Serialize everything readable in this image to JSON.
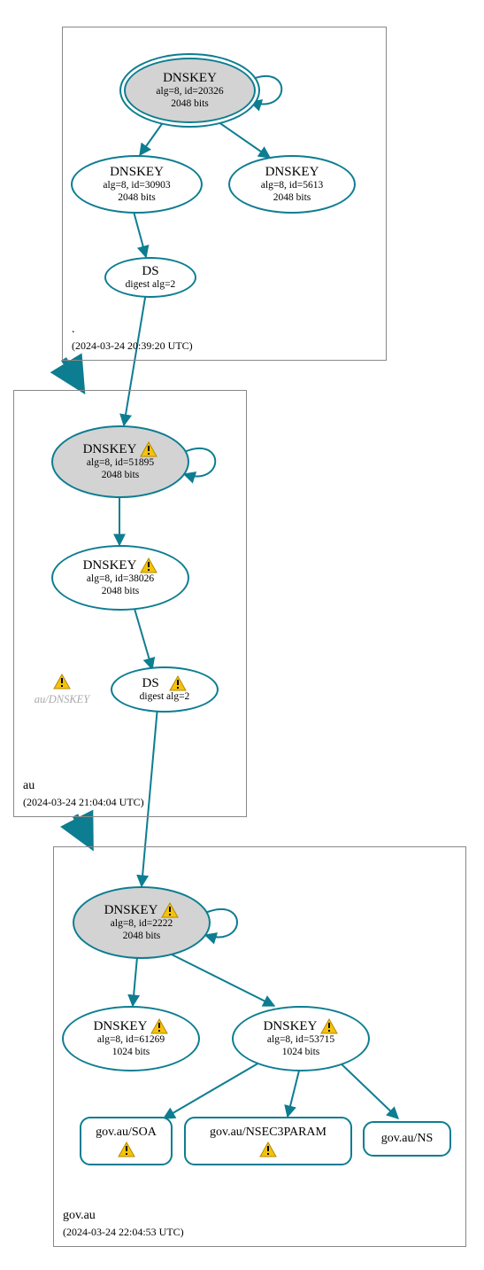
{
  "colors": {
    "stroke": "#0d7d91",
    "fill_grey": "#d3d3d3",
    "box_border": "#888888"
  },
  "zones": {
    "root": {
      "name": ".",
      "timestamp": "(2024-03-24 20:39:20 UTC)",
      "nodes": {
        "ksk": {
          "title": "DNSKEY",
          "l1": "alg=8, id=20326",
          "l2": "2048 bits"
        },
        "zsk1": {
          "title": "DNSKEY",
          "l1": "alg=8, id=30903",
          "l2": "2048 bits"
        },
        "zsk2": {
          "title": "DNSKEY",
          "l1": "alg=8, id=5613",
          "l2": "2048 bits"
        },
        "ds": {
          "title": "DS",
          "l1": "digest alg=2"
        }
      }
    },
    "au": {
      "name": "au",
      "timestamp": "(2024-03-24 21:04:04 UTC)",
      "ghost": "au/DNSKEY",
      "nodes": {
        "ksk": {
          "title": "DNSKEY",
          "l1": "alg=8, id=51895",
          "l2": "2048 bits"
        },
        "zsk": {
          "title": "DNSKEY",
          "l1": "alg=8, id=38026",
          "l2": "2048 bits"
        },
        "ds": {
          "title": "DS",
          "l1": "digest alg=2"
        }
      }
    },
    "govau": {
      "name": "gov.au",
      "timestamp": "(2024-03-24 22:04:53 UTC)",
      "nodes": {
        "ksk": {
          "title": "DNSKEY",
          "l1": "alg=8, id=2222",
          "l2": "2048 bits"
        },
        "zsk1": {
          "title": "DNSKEY",
          "l1": "alg=8, id=61269",
          "l2": "1024 bits"
        },
        "zsk2": {
          "title": "DNSKEY",
          "l1": "alg=8, id=53715",
          "l2": "1024 bits"
        }
      },
      "rr": {
        "soa": "gov.au/SOA",
        "nsec3": "gov.au/NSEC3PARAM",
        "ns": "gov.au/NS"
      }
    }
  }
}
